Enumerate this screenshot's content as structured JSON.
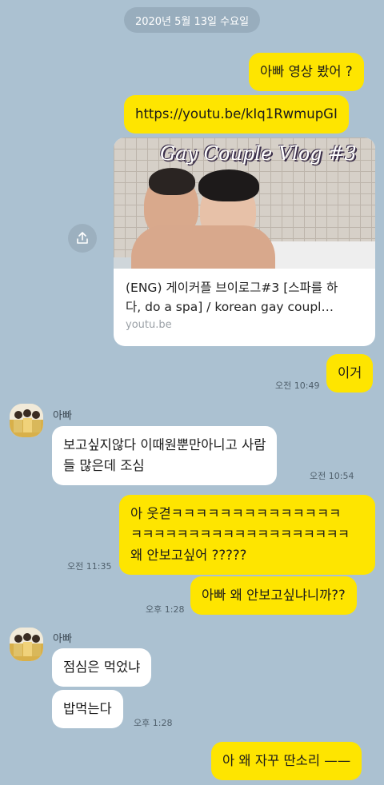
{
  "date_divider": "2020년 5월 13일 수요일",
  "sender_name": "아빠",
  "link_card": {
    "thumbnail_title": "Gay Couple Vlog #3",
    "title_line1": "(ENG) 게이커플 브이로그#3  [스파를 하",
    "title_line2": "다, do a spa] / korean gay coupl…",
    "domain": "youtu.be"
  },
  "messages": {
    "m1": "아빠 영상 봤어 ?",
    "m2": "https://youtu.be/kIq1RwmupGI",
    "m3": "이거",
    "t3": "오전 10:49",
    "m4_line1": "보고싶지않다 이때원뿐만아니고 사람",
    "m4_line2": "들 많은데 조심",
    "t4": "오전 10:54",
    "m5_line1": "아 웃겯ㅋㅋㅋㅋㅋㅋㅋㅋㅋㅋㅋㅋㅋㅋ",
    "m5_line2": "ㅋㅋㅋㅋㅋㅋㅋㅋㅋㅋㅋㅋㅋㅋㅋㅋㅋㅋㅋ",
    "m5_line3": "왜 안보고싶어 ?????",
    "t5": "오전 11:35",
    "m6": "아빠 왜 안보고싶냐니까??",
    "t6": "오후 1:28",
    "m7": "점심은 먹었냐",
    "m8": "밥먹는다",
    "t8": "오후 1:28",
    "m9": "아 왜 자꾸 딴소리 ——"
  },
  "colors": {
    "background": "#abc1d1",
    "my_bubble": "#fee500",
    "their_bubble": "#ffffff"
  }
}
